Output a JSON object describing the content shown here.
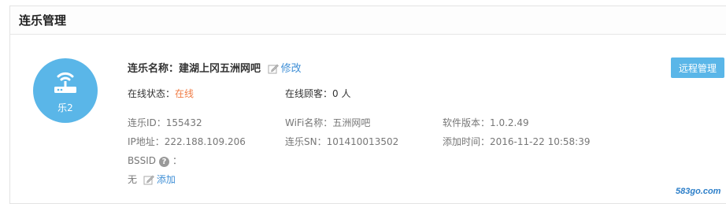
{
  "panel": {
    "title": "连乐管理"
  },
  "device": {
    "avatar_label": "乐2",
    "name_label": "连乐名称：",
    "name": "建湖上冈五洲网吧",
    "edit_label": "修改",
    "remote_button": "远程管理",
    "status_label": "在线状态：",
    "status_value": "在线",
    "customers_label": "在线顾客：",
    "customers_value": "0 人",
    "id_label": "连乐ID：",
    "id_value": "155432",
    "wifi_label": "WiFi名称：",
    "wifi_value": "五洲网吧",
    "version_label": "软件版本：",
    "version_value": "1.0.2.49",
    "ip_label": "IP地址：",
    "ip_value": "222.188.109.206",
    "sn_label": "连乐SN：",
    "sn_value": "101410013502",
    "added_label": "添加时间：",
    "added_value": "2016-11-22 10:58:39",
    "bssid_label": "BSSID",
    "bssid_help": "?",
    "bssid_colon": "：",
    "bssid_value": "无",
    "bssid_add_label": "添加"
  },
  "colors": {
    "accent": "#5ab6e8",
    "link": "#3f8fd6",
    "online": "#f07c45"
  },
  "icons": {
    "avatar": "router-icon",
    "edit": "edit-icon",
    "help": "help-icon"
  },
  "watermark": "583go.com"
}
